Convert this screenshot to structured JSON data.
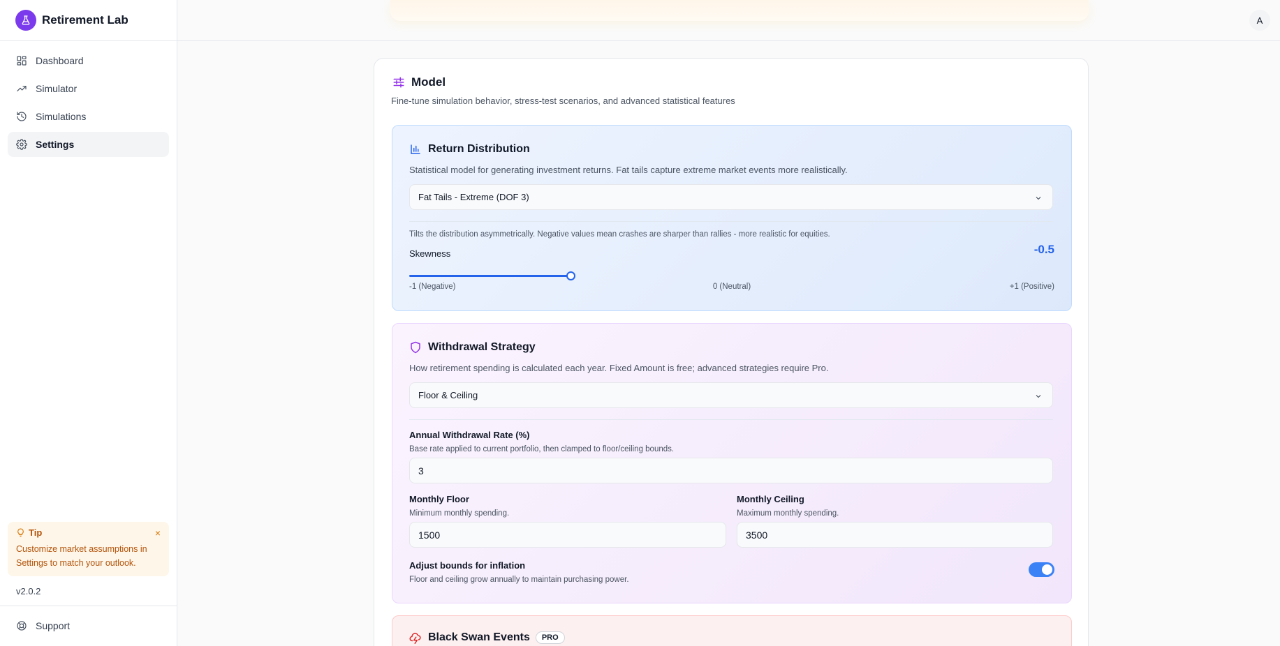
{
  "app": {
    "name": "Retirement Lab",
    "user_initial": "A",
    "version": "v2.0.2"
  },
  "sidebar": {
    "items": [
      {
        "label": "Dashboard",
        "icon": "dashboard-icon"
      },
      {
        "label": "Simulator",
        "icon": "trend-up-icon"
      },
      {
        "label": "Simulations",
        "icon": "history-icon"
      },
      {
        "label": "Settings",
        "icon": "gear-icon",
        "active": true
      }
    ],
    "support_label": "Support"
  },
  "tip": {
    "title": "Tip",
    "text": "Customize market assumptions in Settings to match your outlook.",
    "close": "×"
  },
  "model": {
    "title": "Model",
    "description": "Fine-tune simulation behavior, stress-test scenarios, and advanced statistical features"
  },
  "return_distribution": {
    "title": "Return Distribution",
    "description": "Statistical model for generating investment returns. Fat tails capture extreme market events more realistically.",
    "selected": "Fat Tails - Extreme (DOF 3)",
    "skew_help": "Tilts the distribution asymmetrically. Negative values mean crashes are sharper than rallies - more realistic for equities.",
    "skew_label": "Skewness",
    "skew_value": "-0.5",
    "skew_numeric": -0.5,
    "skew_min": -1,
    "skew_max": 1,
    "tick_min": "-1 (Negative)",
    "tick_mid": "0 (Neutral)",
    "tick_max": "+1 (Positive)"
  },
  "withdrawal": {
    "title": "Withdrawal Strategy",
    "description": "How retirement spending is calculated each year. Fixed Amount is free; advanced strategies require Pro.",
    "selected": "Floor & Ceiling",
    "rate_label": "Annual Withdrawal Rate (%)",
    "rate_help": "Base rate applied to current portfolio, then clamped to floor/ceiling bounds.",
    "rate_value": "3",
    "floor_label": "Monthly Floor",
    "floor_help": "Minimum monthly spending.",
    "floor_value": "1500",
    "ceiling_label": "Monthly Ceiling",
    "ceiling_help": "Maximum monthly spending.",
    "ceiling_value": "3500",
    "inflation_label": "Adjust bounds for inflation",
    "inflation_help": "Floor and ceiling grow annually to maintain purchasing power.",
    "inflation_on": true
  },
  "black_swan": {
    "title": "Black Swan Events",
    "badge": "PRO"
  },
  "colors": {
    "brand": "#7c3aed",
    "accent_blue": "#2563eb",
    "tip_text": "#b45309",
    "toggle_on": "#3b82f6"
  }
}
